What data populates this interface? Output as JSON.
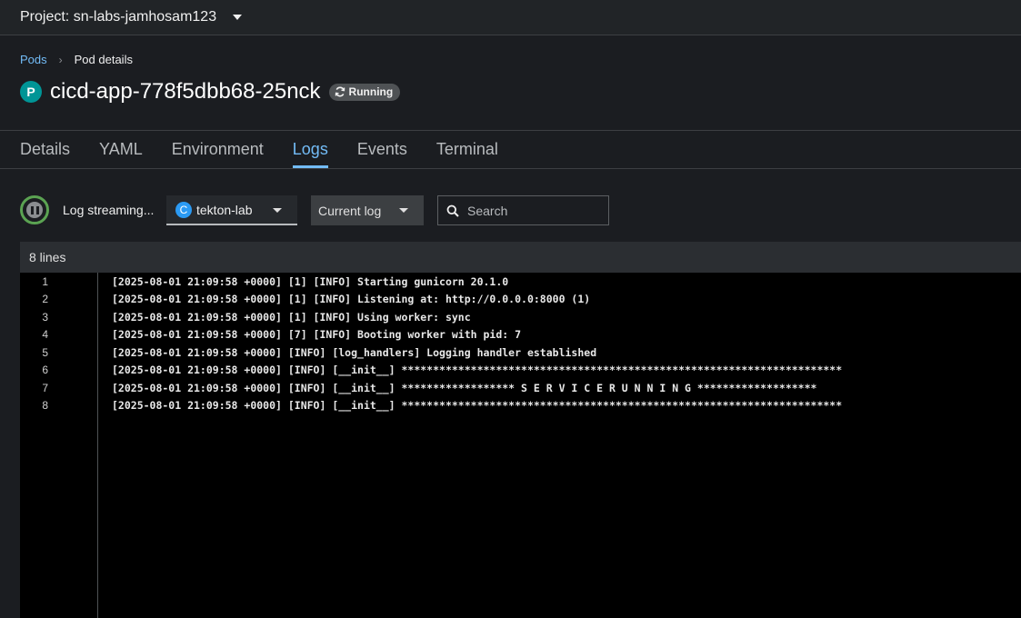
{
  "project": {
    "label": "Project: sn-labs-jamhosam123"
  },
  "breadcrumb": {
    "parent": "Pods",
    "current": "Pod details"
  },
  "pod": {
    "badge": "P",
    "name": "cicd-app-778f5dbb68-25nck",
    "status": "Running"
  },
  "tabs": [
    "Details",
    "YAML",
    "Environment",
    "Logs",
    "Events",
    "Terminal"
  ],
  "active_tab": "Logs",
  "toolbar": {
    "stream_label": "Log streaming...",
    "container_badge": "C",
    "container": "tekton-lab",
    "log_type": "Current log",
    "search_placeholder": "Search"
  },
  "log": {
    "line_count": "8 lines",
    "lines": [
      {
        "num": "1",
        "text": "[2025-08-01 21:09:58 +0000] [1] [INFO] Starting gunicorn 20.1.0"
      },
      {
        "num": "2",
        "text": "[2025-08-01 21:09:58 +0000] [1] [INFO] Listening at: http://0.0.0.0:8000 (1)"
      },
      {
        "num": "3",
        "text": "[2025-08-01 21:09:58 +0000] [1] [INFO] Using worker: sync"
      },
      {
        "num": "4",
        "text": "[2025-08-01 21:09:58 +0000] [7] [INFO] Booting worker with pid: 7"
      },
      {
        "num": "5",
        "text": "[2025-08-01 21:09:58 +0000] [INFO] [log_handlers] Logging handler established"
      },
      {
        "num": "6",
        "text": "[2025-08-01 21:09:58 +0000] [INFO] [__init__] **********************************************************************"
      },
      {
        "num": "7",
        "text": "[2025-08-01 21:09:58 +0000] [INFO] [__init__] ****************** S E R V I C E R U N N I N G *******************"
      },
      {
        "num": "8",
        "text": "[2025-08-01 21:09:58 +0000] [INFO] [__init__] **********************************************************************"
      }
    ]
  },
  "colors": {
    "accent": "#73bcf7",
    "pod_badge": "#009596",
    "stream_ring": "#5ba352",
    "container_badge": "#2b9af3"
  }
}
